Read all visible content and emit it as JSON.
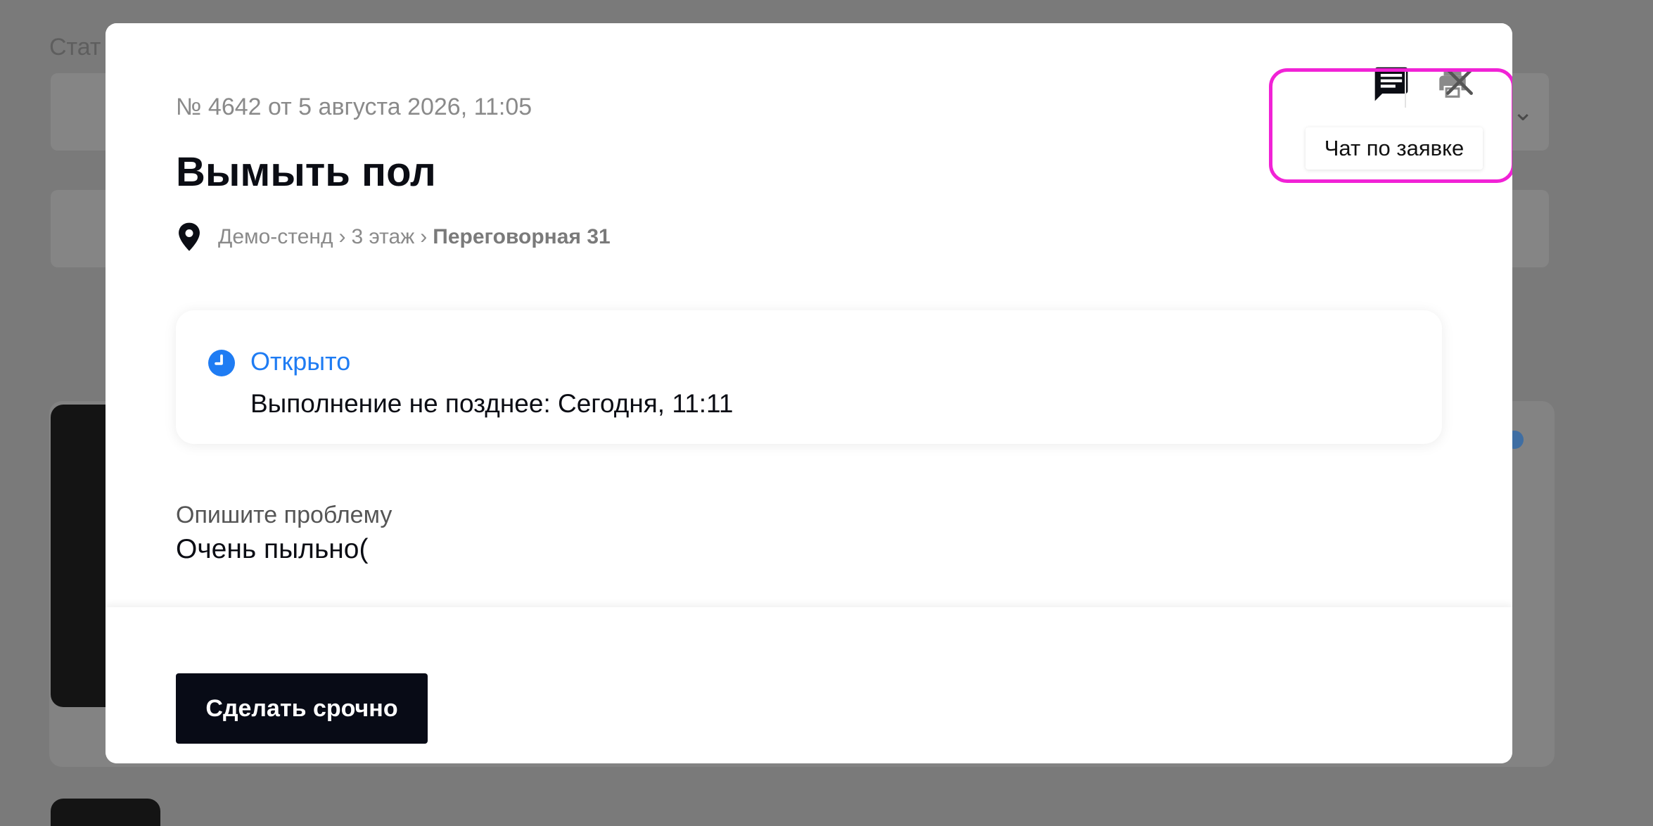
{
  "background": {
    "label_hint": "Стат"
  },
  "request": {
    "meta": "№ 4642 от 5 августа 2026, 11:05",
    "title": "Вымыть пол",
    "location": {
      "parts": [
        "Демо-стенд",
        "3 этаж",
        "Переговорная 31"
      ],
      "separator": "›"
    }
  },
  "status": {
    "label": "Открыто",
    "deadline": "Выполнение не позднее: Сегодня, 11:11",
    "color": "#1f7cf3"
  },
  "description": {
    "label": "Опишите проблему",
    "value": "Очень пыльно("
  },
  "actions": {
    "urgent_label": "Сделать срочно",
    "chat_tooltip": "Чат по заявке",
    "chat_icon": "chat-icon",
    "print_icon": "print-icon",
    "close_icon": "close-icon"
  },
  "colors": {
    "highlight": "#f122d6",
    "primary_button": "#080b16"
  }
}
